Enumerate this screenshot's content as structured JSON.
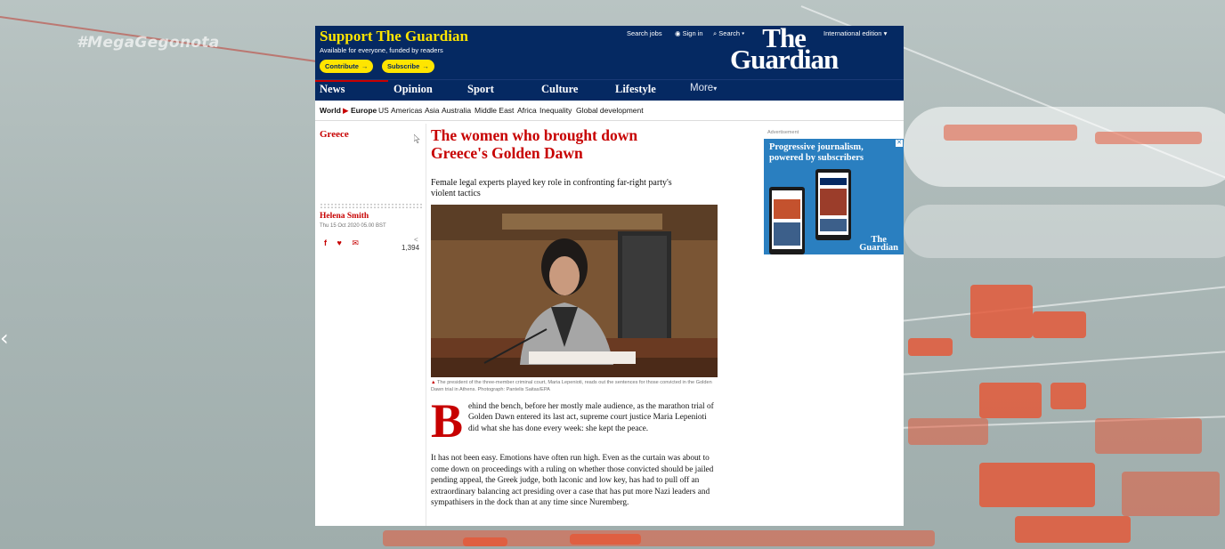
{
  "overlay": {
    "hashtag": "#MegaGegonota"
  },
  "header": {
    "support_title": "Support The Guardian",
    "support_subtitle": "Available for everyone, funded by readers",
    "contribute_label": "Contribute",
    "subscribe_label": "Subscribe",
    "search_jobs": "Search jobs",
    "sign_in": "Sign in",
    "search": "Search",
    "edition": "International edition",
    "logo_line1": "The",
    "logo_line2": "Guardian"
  },
  "nav": {
    "items": [
      "News",
      "Opinion",
      "Sport",
      "Culture",
      "Lifestyle"
    ],
    "more": "More",
    "active": "News"
  },
  "subnav": {
    "items": [
      "World",
      "Europe",
      "US",
      "Americas",
      "Asia",
      "Australia",
      "Middle East",
      "Africa",
      "Inequality",
      "Global development"
    ],
    "active": "Europe"
  },
  "article": {
    "section": "Greece",
    "byline": "Helena Smith",
    "date": "Thu 15 Oct 2020 05.00 BST",
    "share_count": "1,394",
    "headline": "The women who brought down Greece's Golden Dawn",
    "standfirst": "Female legal experts played key role in confronting far-right party's violent tactics",
    "caption": "The president of the three-member criminal court, Maria Lepenioti, reads out the sentences for those convicted in the Golden Dawn trial in Athens. Photograph: Pantelis Saitas/EPA",
    "dropcap": "B",
    "para1": "ehind the bench, before her mostly male audience, as the marathon trial of Golden Dawn entered its last act, supreme court justice Maria Lepenioti did what she has done every week: she kept the peace.",
    "para2": "It has not been easy. Emotions have often run high. Even as the curtain was about to come down on proceedings with a ruling on whether those convicted should be jailed pending appeal, the Greek judge, both laconic and low key, has had to pull off an extraordinary balancing act presiding over a case that has put more Nazi leaders and sympathisers in the dock than at any time since Nuremberg."
  },
  "ad": {
    "label": "Advertisement",
    "text": "Progressive journalism, powered by subscribers",
    "logo_line1": "The",
    "logo_line2": "Guardian"
  },
  "colors": {
    "brand_blue": "#052962",
    "brand_red": "#c70000",
    "brand_yellow": "#ffe500",
    "ad_blue": "#2a7fc0"
  },
  "icons": [
    "user-icon",
    "search-icon",
    "facebook-icon",
    "twitter-icon",
    "email-icon",
    "share-icon",
    "close-icon"
  ]
}
